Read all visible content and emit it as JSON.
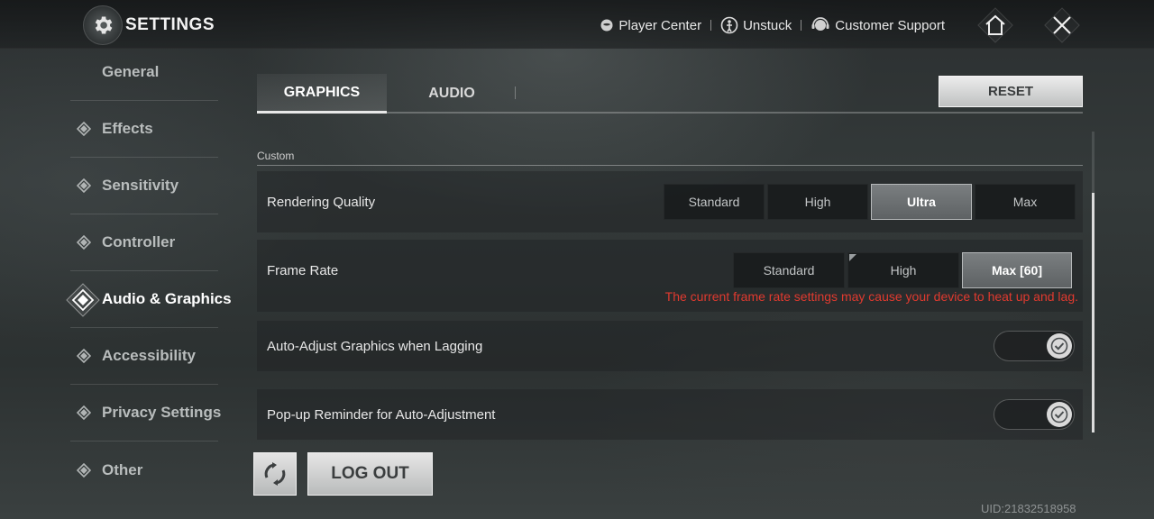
{
  "header": {
    "title": "SETTINGS",
    "links": [
      {
        "label": "Player Center",
        "icon": "player-center-icon"
      },
      {
        "label": "Unstuck",
        "icon": "unstuck-icon"
      },
      {
        "label": "Customer Support",
        "icon": "customer-support-icon"
      }
    ],
    "home_icon": "home-icon",
    "close_icon": "close-icon"
  },
  "sidebar": {
    "items": [
      {
        "label": "General",
        "active": false
      },
      {
        "label": "Effects",
        "active": false
      },
      {
        "label": "Sensitivity",
        "active": false
      },
      {
        "label": "Controller",
        "active": false
      },
      {
        "label": "Audio & Graphics",
        "active": true
      },
      {
        "label": "Accessibility",
        "active": false
      },
      {
        "label": "Privacy Settings",
        "active": false
      },
      {
        "label": "Other",
        "active": false
      }
    ]
  },
  "tabs": [
    {
      "label": "GRAPHICS",
      "active": true
    },
    {
      "label": "AUDIO",
      "active": false
    }
  ],
  "reset_label": "RESET",
  "section": "Custom",
  "settings": {
    "rendering_quality": {
      "label": "Rendering Quality",
      "options": [
        "Standard",
        "High",
        "Ultra",
        "Max"
      ],
      "selected": "Ultra"
    },
    "frame_rate": {
      "label": "Frame Rate",
      "options": [
        "Standard",
        "High",
        "Max [60]"
      ],
      "selected": "Max [60]",
      "warning": "The current frame rate settings may cause your device to heat up and lag."
    },
    "auto_adjust": {
      "label": "Auto-Adjust Graphics when Lagging",
      "enabled": true
    },
    "popup_reminder": {
      "label": "Pop-up Reminder for Auto-Adjustment",
      "enabled": true
    }
  },
  "footer": {
    "logout_label": "LOG OUT",
    "uid": "UID:21832518958"
  },
  "colors": {
    "warning": "#e03a2f",
    "accent": "#e8e8e8"
  }
}
